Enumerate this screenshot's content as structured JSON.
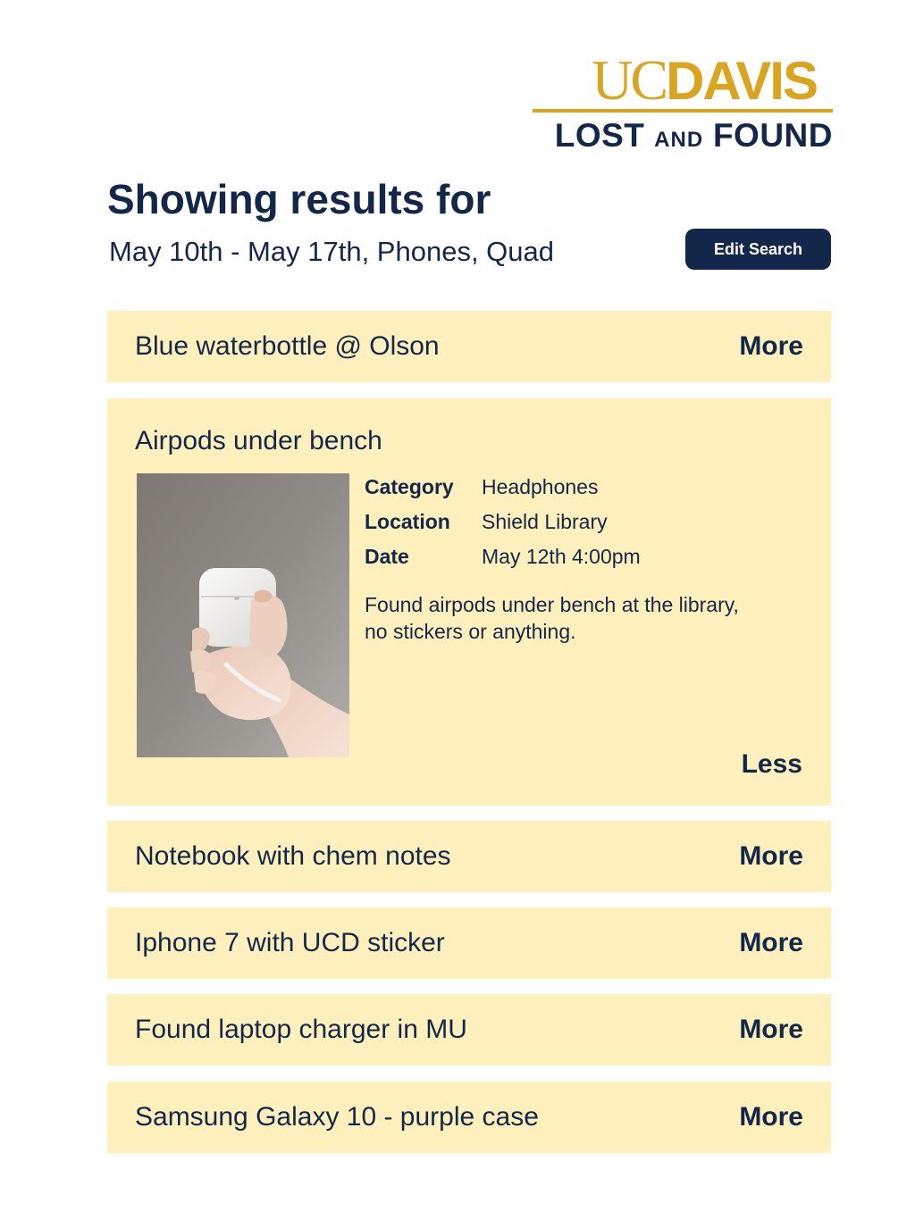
{
  "logo": {
    "uc": "UC",
    "davis": "DAVIS",
    "lost": "LOST",
    "and": "AND",
    "found": "FOUND"
  },
  "heading": "Showing results for",
  "criteria": "May 10th - May 17th, Phones, Quad",
  "edit_search_label": "Edit Search",
  "colors": {
    "navy": "#13274a",
    "gold": "#d9a521",
    "card_background": "#fef0bd"
  },
  "results": [
    {
      "title": "Blue waterbottle @ Olson",
      "toggle": "More"
    },
    {
      "title": "Airpods under bench",
      "toggle": "Less",
      "details": [
        {
          "key": "Category",
          "value": "Headphones"
        },
        {
          "key": "Location",
          "value": "Shield Library"
        },
        {
          "key": "Date",
          "value": "May 12th 4:00pm"
        }
      ],
      "description": "Found airpods under bench at the library, no stickers or anything."
    },
    {
      "title": "Notebook with chem notes",
      "toggle": "More"
    },
    {
      "title": "Iphone 7 with UCD sticker",
      "toggle": "More"
    },
    {
      "title": "Found laptop charger in MU",
      "toggle": "More"
    },
    {
      "title": "Samsung Galaxy 10 - purple case",
      "toggle": "More"
    }
  ]
}
